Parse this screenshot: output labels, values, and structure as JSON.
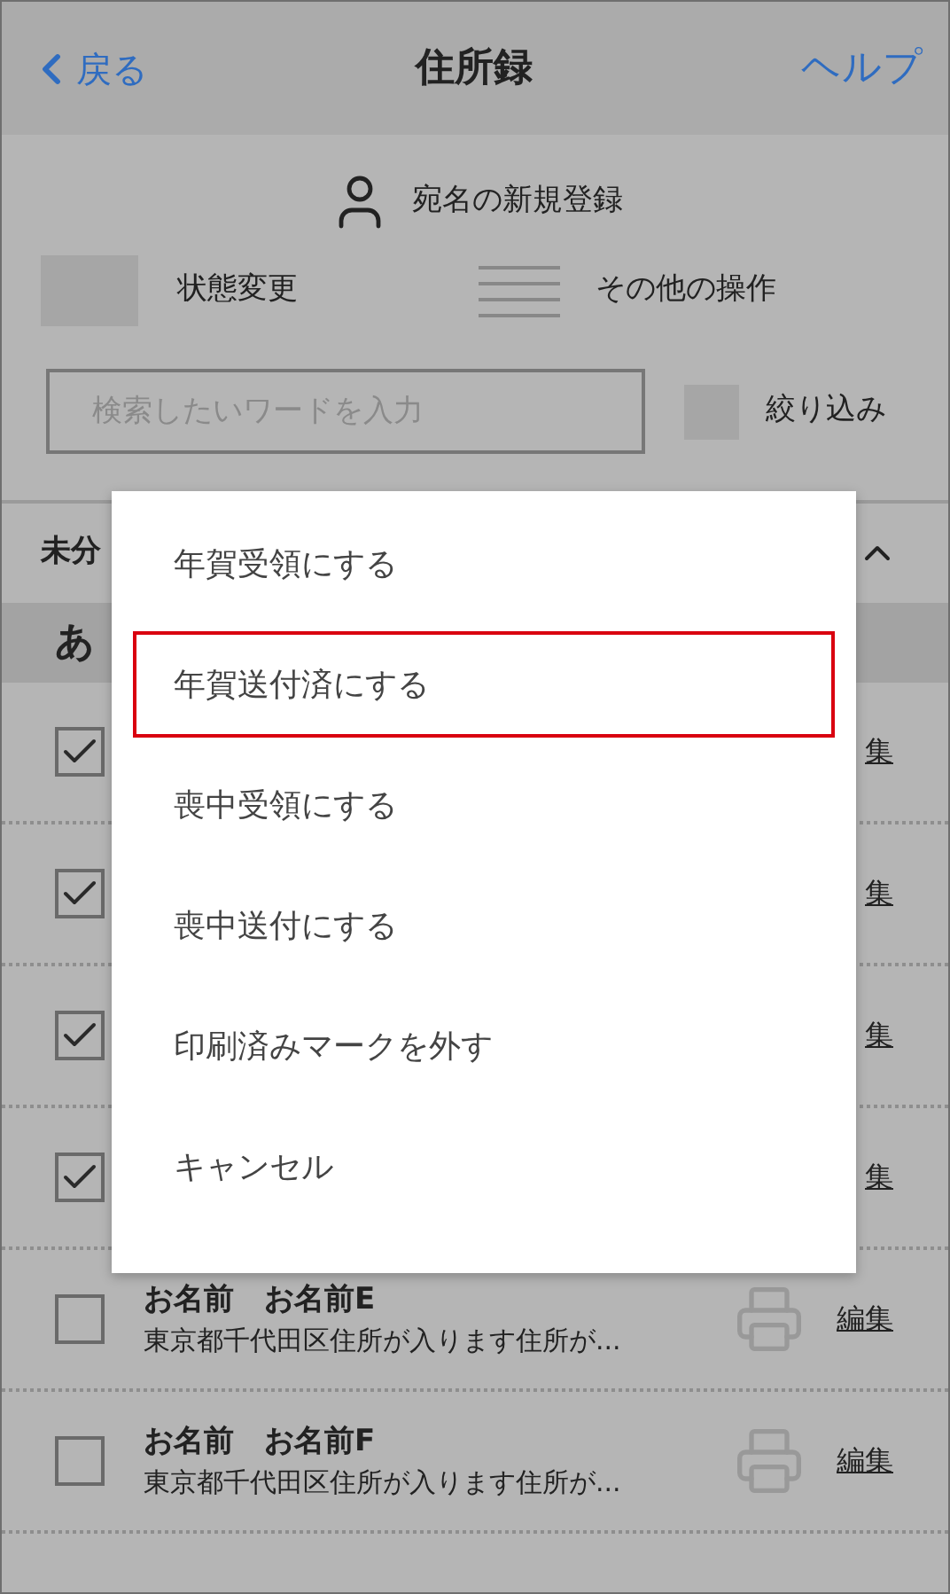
{
  "header": {
    "back": "戻る",
    "title": "住所録",
    "help": "ヘルプ"
  },
  "new_entry": "宛名の新規登録",
  "toolbar": {
    "status_change": "状態変更",
    "other_actions": "その他の操作"
  },
  "search": {
    "placeholder": "検索したいワードを入力"
  },
  "filter": {
    "label": "絞り込み",
    "checked": false
  },
  "group": {
    "title": "未分",
    "expanded": true
  },
  "index": "あ",
  "rows": [
    {
      "checked": true,
      "edit": "集"
    },
    {
      "checked": true,
      "edit": "集"
    },
    {
      "checked": true,
      "edit": "集"
    },
    {
      "checked": true,
      "edit": "集"
    },
    {
      "checked": false,
      "name": "お名前　お名前E",
      "address": "東京都千代田区住所が入ります住所が...",
      "edit": "編集"
    },
    {
      "checked": false,
      "name": "お名前　お名前F",
      "address": "東京都千代田区住所が入ります住所が...",
      "edit": "編集"
    }
  ],
  "menu": {
    "items": [
      {
        "label": "年賀受領にする",
        "selected": false
      },
      {
        "label": "年賀送付済にする",
        "selected": true
      },
      {
        "label": "喪中受領にする",
        "selected": false
      },
      {
        "label": "喪中送付にする",
        "selected": false
      },
      {
        "label": "印刷済みマークを外す",
        "selected": false
      },
      {
        "label": "キャンセル",
        "selected": false
      }
    ]
  }
}
